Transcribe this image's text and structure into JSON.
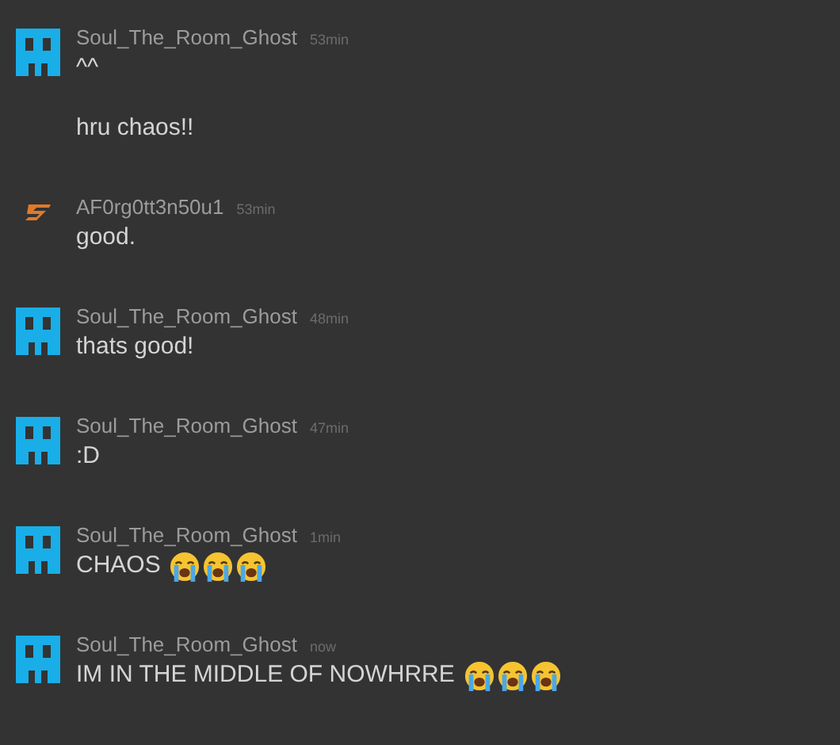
{
  "messages": [
    {
      "user": "Soul_The_Room_Ghost",
      "time": "53min",
      "kind": "ghost",
      "lines": [
        "^^",
        "hru chaos!!"
      ]
    },
    {
      "user": "AF0rg0tt3n50u1",
      "time": "53min",
      "kind": "bolt",
      "lines": [
        "good."
      ]
    },
    {
      "user": "Soul_The_Room_Ghost",
      "time": "48min",
      "kind": "ghost",
      "lines": [
        "thats good!"
      ]
    },
    {
      "user": "Soul_The_Room_Ghost",
      "time": "47min",
      "kind": "ghost",
      "lines": [
        ":D"
      ]
    },
    {
      "user": "Soul_The_Room_Ghost",
      "time": "1min",
      "kind": "ghost",
      "lines": [
        "CHAOS"
      ],
      "emojis": [
        {
          "kind": "crying"
        },
        {
          "kind": "crying"
        },
        {
          "kind": "crying"
        }
      ]
    },
    {
      "user": "Soul_The_Room_Ghost",
      "time": "now",
      "kind": "ghost",
      "lines": [
        "IM IN THE MIDDLE OF NOWHRRE"
      ],
      "emojis": [
        {
          "kind": "crying"
        },
        {
          "kind": "crying"
        },
        {
          "kind": "crying"
        }
      ]
    }
  ]
}
